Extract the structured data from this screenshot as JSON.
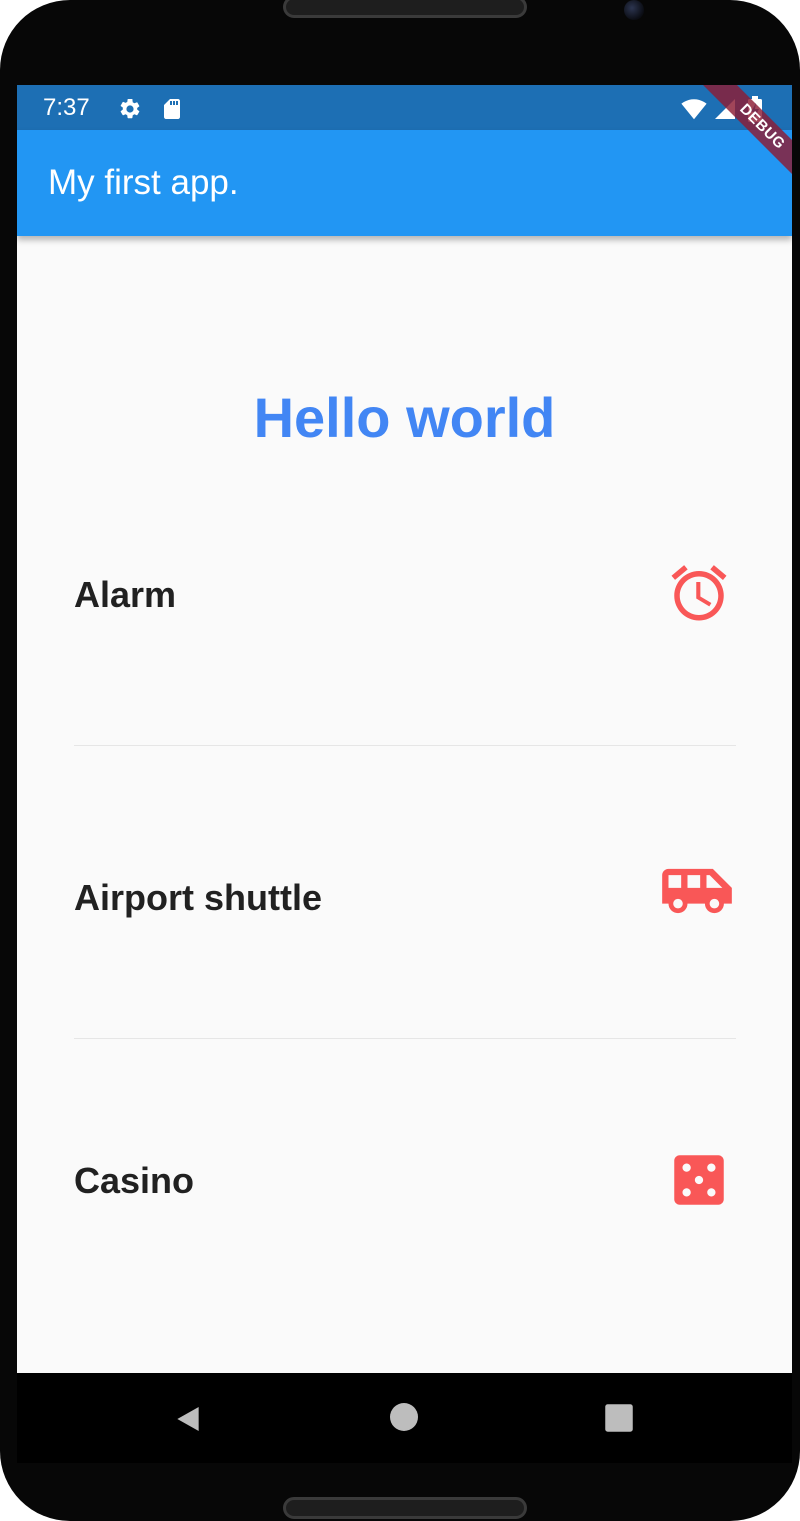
{
  "status_bar": {
    "time": "7:37",
    "left_icons": [
      "settings-icon",
      "sd-card-icon"
    ],
    "right_icons": [
      "wifi-icon",
      "signal-icon",
      "battery-charging-icon"
    ]
  },
  "app_bar": {
    "title": "My first app.",
    "debug_banner": "DEBUG",
    "color": "#2296f3"
  },
  "main": {
    "heading": "Hello world",
    "heading_color": "#4286f4",
    "items": [
      {
        "label": "Alarm",
        "icon": "alarm-icon"
      },
      {
        "label": "Airport shuttle",
        "icon": "airport-shuttle-icon"
      },
      {
        "label": "Casino",
        "icon": "casino-dice-icon"
      }
    ],
    "icon_color": "#f95757"
  },
  "nav_bar": {
    "buttons": [
      "back-icon",
      "home-icon",
      "recents-icon"
    ]
  }
}
